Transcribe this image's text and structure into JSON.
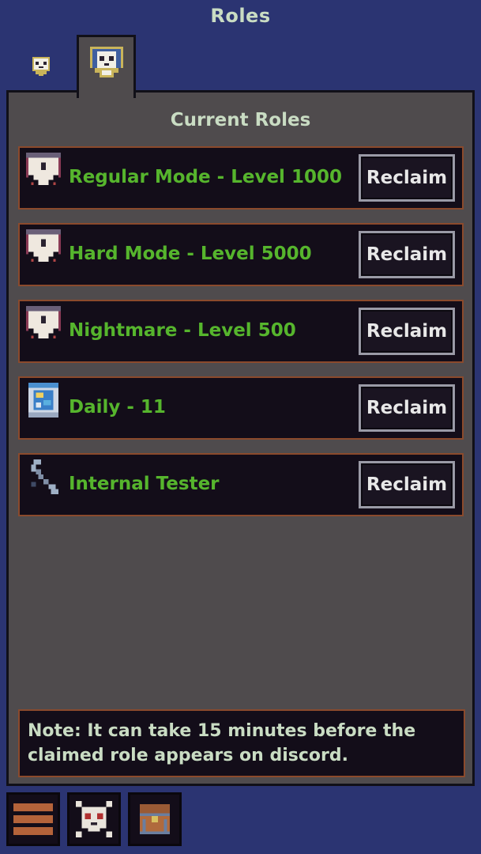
{
  "header": {
    "title": "Roles"
  },
  "tabs": [
    {
      "icon": "small-shield-skull-icon",
      "active": false
    },
    {
      "icon": "shield-skull-icon",
      "active": true
    }
  ],
  "main": {
    "section_title": "Current Roles",
    "roles": [
      {
        "label": "Regular Mode - Level 1000",
        "icon": "banner-skull-icon",
        "button": "Reclaim"
      },
      {
        "label": "Hard Mode - Level 5000",
        "icon": "banner-skull-icon",
        "button": "Reclaim"
      },
      {
        "label": "Nightmare - Level 500",
        "icon": "banner-skull-icon",
        "button": "Reclaim"
      },
      {
        "label": "Daily - 11",
        "icon": "calendar-globe-icon",
        "button": "Reclaim"
      },
      {
        "label": "Internal Tester",
        "icon": "wrench-icon",
        "button": "Reclaim"
      }
    ],
    "note": "Note: It can take 15 minutes before the claimed role appears on discord."
  },
  "bottom_nav": [
    {
      "icon": "menu-icon"
    },
    {
      "icon": "skull-crossbones-icon"
    },
    {
      "icon": "treasure-chest-icon"
    }
  ],
  "colors": {
    "background": "#2b3472",
    "panel": "#4f4b4d",
    "row_bg": "#130d19",
    "row_border": "#8b4a2c",
    "role_text": "#56b52d",
    "title_text": "#c9dcc3"
  }
}
